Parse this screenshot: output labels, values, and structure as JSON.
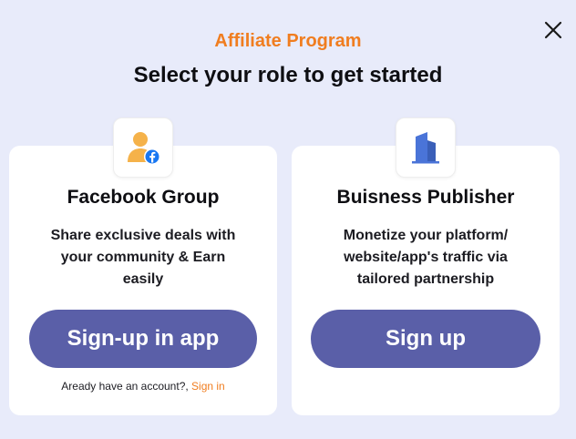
{
  "modal": {
    "subtitle": "Affiliate Program",
    "title": "Select your role to get started",
    "close_icon": "close-icon"
  },
  "cards": [
    {
      "icon": "facebook-group-user-icon",
      "title": "Facebook Group",
      "description_lines": [
        "Share exclusive deals with",
        "your community & Earn",
        "easily"
      ],
      "button_label": "Sign-up in app",
      "signin_prompt": "Aready have an account?, ",
      "signin_link": "Sign in"
    },
    {
      "icon": "building-icon",
      "title": "Buisness Publisher",
      "description_lines": [
        "Monetize your platform/",
        "website/app's traffic via",
        "tailored partnership"
      ],
      "button_label": "Sign up"
    }
  ],
  "colors": {
    "background": "#e8ebfa",
    "accent_orange": "#f07d1f",
    "button_purple": "#5a5fa8",
    "icon_blue": "#4a74d8",
    "facebook_blue": "#1877f2",
    "user_orange": "#f5b24a"
  }
}
